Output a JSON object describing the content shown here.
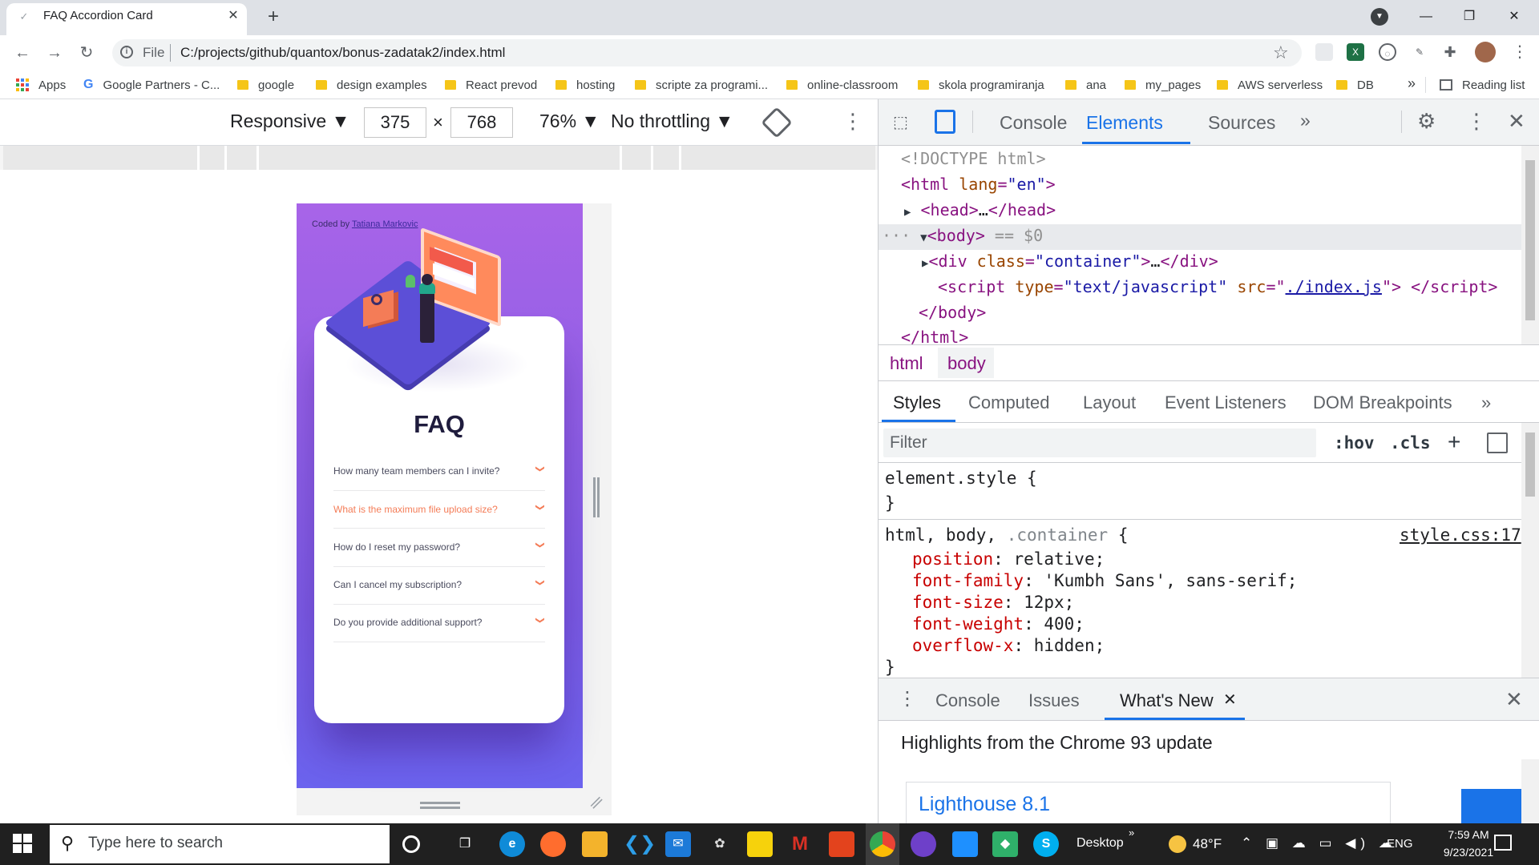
{
  "browser": {
    "tab_title": "FAQ Accordion Card",
    "tab_favicon": "chevron-icon",
    "url_scheme_label": "File",
    "url": "C:/projects/github/quantox/bonus-zadatak2/index.html"
  },
  "bookmarks": [
    {
      "label": "Apps",
      "icon": "apps-icon"
    },
    {
      "label": "Google Partners - C...",
      "icon": "google-icon"
    },
    {
      "label": "google",
      "icon": "folder-icon"
    },
    {
      "label": "design examples",
      "icon": "folder-icon"
    },
    {
      "label": "React prevod",
      "icon": "folder-icon"
    },
    {
      "label": "hosting",
      "icon": "folder-icon"
    },
    {
      "label": "scripte za programi...",
      "icon": "folder-icon"
    },
    {
      "label": "online-classroom",
      "icon": "folder-icon"
    },
    {
      "label": "skola programiranja",
      "icon": "folder-icon"
    },
    {
      "label": "ana",
      "icon": "folder-icon"
    },
    {
      "label": "my_pages",
      "icon": "folder-icon"
    },
    {
      "label": "AWS serverless",
      "icon": "folder-icon"
    },
    {
      "label": "DB",
      "icon": "folder-icon"
    },
    {
      "label": "Reading list",
      "icon": "reading-list-icon"
    }
  ],
  "device_toolbar": {
    "mode": "Responsive ▼",
    "width": "375",
    "height": "768",
    "times": "×",
    "zoom": "76% ▼",
    "throttling": "No throttling ▼"
  },
  "page": {
    "coded_by_prefix": "Coded by ",
    "coded_by_name": "Tatiana Markovic",
    "faq_title": "FAQ",
    "questions": [
      {
        "text": "How many team members can I invite?",
        "active": false
      },
      {
        "text": "What is the maximum file upload size?",
        "active": true
      },
      {
        "text": "How do I reset my password?",
        "active": false
      },
      {
        "text": "Can I cancel my subscription?",
        "active": false
      },
      {
        "text": "Do you provide additional support?",
        "active": false
      }
    ],
    "accent_color": "#f47c57",
    "gradient_top": "#a864e8",
    "gradient_bottom": "#6b63ee"
  },
  "devtools": {
    "tabs": [
      "Console",
      "Elements",
      "Sources"
    ],
    "active_tab": "Elements",
    "more_tabs": "»",
    "tree": {
      "doctype": "<!DOCTYPE html>",
      "html_open_tag": "html",
      "html_lang_attr": "lang",
      "html_lang_val": "\"en\"",
      "head": "head",
      "head_ellipsis": "…",
      "body_tag": "body",
      "body_marker": "== $0",
      "selection_dots": "···",
      "div_tag": "div",
      "div_class_attr": "class",
      "div_class_val": "\"container\"",
      "script_tag": "script",
      "script_type_attr": "type",
      "script_type_val": "\"text/javascript\"",
      "script_src_attr": "src",
      "script_src_val": "./index.js",
      "body_close": "</body>",
      "html_close": "</html>"
    },
    "breadcrumbs": [
      "html",
      "body"
    ],
    "style_tabs": [
      "Styles",
      "Computed",
      "Layout",
      "Event Listeners",
      "DOM Breakpoints"
    ],
    "style_more": "»",
    "filter_placeholder": "Filter",
    "hov": ":hov",
    "cls": ".cls",
    "plus": "+",
    "element_style_open": "element.style {",
    "close_brace": "}",
    "rule_selector_main": "html, body,",
    "rule_selector_dim": ".container",
    "rule_open": "{",
    "rule_source": "style.css:17",
    "declarations": [
      {
        "prop": "position",
        "value": "relative;"
      },
      {
        "prop": "font-family",
        "value": "'Kumbh Sans', sans-serif;"
      },
      {
        "prop": "font-size",
        "value": "12px;"
      },
      {
        "prop": "font-weight",
        "value": "400;"
      },
      {
        "prop": "overflow-x",
        "value": "hidden;"
      }
    ],
    "drawer_tabs": [
      "Console",
      "Issues",
      "What's New"
    ],
    "drawer_active": "What's New",
    "highlights": "Highlights from the Chrome 93 update",
    "lighthouse_title": "Lighthouse 8.1"
  },
  "taskbar": {
    "search_placeholder": "Type here to search",
    "desktop_label": "Desktop",
    "temperature": "48°F",
    "language": "ENG",
    "time": "7:59 AM",
    "date": "9/23/2021"
  }
}
